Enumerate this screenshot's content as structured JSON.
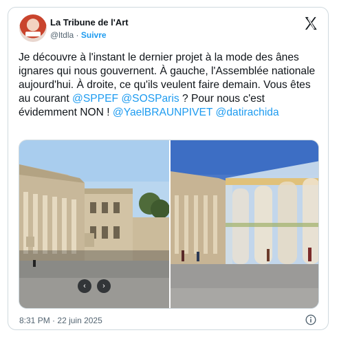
{
  "account": {
    "name": "La Tribune de l'Art",
    "handle": "@ltdla",
    "separator": "·",
    "follow_label": "Suivre"
  },
  "tweet": {
    "segments": [
      {
        "text": "Je découvre à l'instant le dernier projet à la mode des ânes ignares qui nous gouvernent. À gauche, l'Assemblée nationale aujourd'hui. À droite, ce qu'ils veulent faire demain. Vous êtes au courant ",
        "mention": false
      },
      {
        "text": "@SPPEF",
        "mention": true
      },
      {
        "text": " ",
        "mention": false
      },
      {
        "text": "@SOSParis",
        "mention": true
      },
      {
        "text": " ? Pour nous c'est évidemment NON ! ",
        "mention": false
      },
      {
        "text": "@YaelBRAUNPIVET",
        "mention": true
      },
      {
        "text": " ",
        "mention": false
      },
      {
        "text": "@datirachida",
        "mention": true
      }
    ]
  },
  "media": {
    "left_image": "assemblee-nationale-today-photo",
    "right_image": "assemblee-nationale-glass-project-render",
    "prev_icon": "‹",
    "next_icon": "›"
  },
  "footer": {
    "time": "8:31 PM",
    "separator": "·",
    "date": "22 juin 2025"
  },
  "colors": {
    "accent": "#1d9bf0",
    "text": "#0f1419",
    "muted": "#536471",
    "border": "#cfd9de"
  },
  "icons": {
    "logo": "x-logo-icon",
    "info": "info-icon"
  }
}
